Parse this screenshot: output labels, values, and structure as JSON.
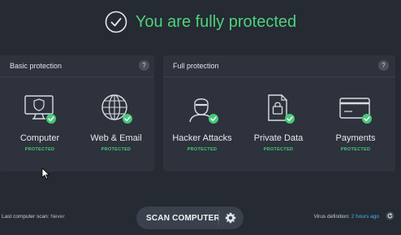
{
  "status": {
    "title": "You are fully protected",
    "icon": "check-circle-icon"
  },
  "basic": {
    "title": "Basic protection",
    "help": "?",
    "tiles": [
      {
        "label": "Computer",
        "status": "PROTECTED",
        "icon": "monitor-shield-icon"
      },
      {
        "label": "Web & Email",
        "status": "PROTECTED",
        "icon": "globe-icon"
      }
    ]
  },
  "full": {
    "title": "Full protection",
    "help": "?",
    "tiles": [
      {
        "label": "Hacker Attacks",
        "status": "PROTECTED",
        "icon": "hacker-icon"
      },
      {
        "label": "Private Data",
        "status": "PROTECTED",
        "icon": "locked-document-icon"
      },
      {
        "label": "Payments",
        "status": "PROTECTED",
        "icon": "credit-card-icon"
      }
    ]
  },
  "scan": {
    "label": "SCAN COMPUTER",
    "settings_icon": "gear-icon"
  },
  "footer": {
    "last_scan_label": "Last computer scan:",
    "last_scan_value": "Never",
    "virus_label": "Virus definition:",
    "virus_value": "2 hours ago",
    "refresh_icon": "refresh-icon"
  },
  "colors": {
    "accent": "#4fd17a",
    "background": "#252a33",
    "panel": "#2d323c",
    "link": "#49b6e8"
  }
}
